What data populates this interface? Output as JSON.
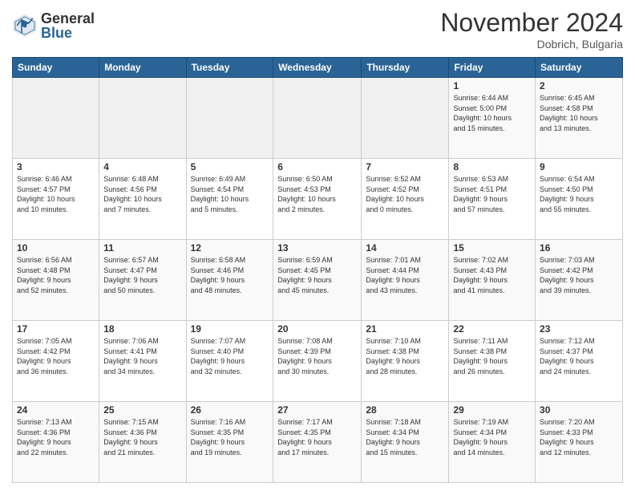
{
  "logo": {
    "general": "General",
    "blue": "Blue"
  },
  "header": {
    "month": "November 2024",
    "location": "Dobrich, Bulgaria"
  },
  "weekdays": [
    "Sunday",
    "Monday",
    "Tuesday",
    "Wednesday",
    "Thursday",
    "Friday",
    "Saturday"
  ],
  "weeks": [
    [
      {
        "day": "",
        "info": ""
      },
      {
        "day": "",
        "info": ""
      },
      {
        "day": "",
        "info": ""
      },
      {
        "day": "",
        "info": ""
      },
      {
        "day": "",
        "info": ""
      },
      {
        "day": "1",
        "info": "Sunrise: 6:44 AM\nSunset: 5:00 PM\nDaylight: 10 hours\nand 15 minutes."
      },
      {
        "day": "2",
        "info": "Sunrise: 6:45 AM\nSunset: 4:58 PM\nDaylight: 10 hours\nand 13 minutes."
      }
    ],
    [
      {
        "day": "3",
        "info": "Sunrise: 6:46 AM\nSunset: 4:57 PM\nDaylight: 10 hours\nand 10 minutes."
      },
      {
        "day": "4",
        "info": "Sunrise: 6:48 AM\nSunset: 4:56 PM\nDaylight: 10 hours\nand 7 minutes."
      },
      {
        "day": "5",
        "info": "Sunrise: 6:49 AM\nSunset: 4:54 PM\nDaylight: 10 hours\nand 5 minutes."
      },
      {
        "day": "6",
        "info": "Sunrise: 6:50 AM\nSunset: 4:53 PM\nDaylight: 10 hours\nand 2 minutes."
      },
      {
        "day": "7",
        "info": "Sunrise: 6:52 AM\nSunset: 4:52 PM\nDaylight: 10 hours\nand 0 minutes."
      },
      {
        "day": "8",
        "info": "Sunrise: 6:53 AM\nSunset: 4:51 PM\nDaylight: 9 hours\nand 57 minutes."
      },
      {
        "day": "9",
        "info": "Sunrise: 6:54 AM\nSunset: 4:50 PM\nDaylight: 9 hours\nand 55 minutes."
      }
    ],
    [
      {
        "day": "10",
        "info": "Sunrise: 6:56 AM\nSunset: 4:48 PM\nDaylight: 9 hours\nand 52 minutes."
      },
      {
        "day": "11",
        "info": "Sunrise: 6:57 AM\nSunset: 4:47 PM\nDaylight: 9 hours\nand 50 minutes."
      },
      {
        "day": "12",
        "info": "Sunrise: 6:58 AM\nSunset: 4:46 PM\nDaylight: 9 hours\nand 48 minutes."
      },
      {
        "day": "13",
        "info": "Sunrise: 6:59 AM\nSunset: 4:45 PM\nDaylight: 9 hours\nand 45 minutes."
      },
      {
        "day": "14",
        "info": "Sunrise: 7:01 AM\nSunset: 4:44 PM\nDaylight: 9 hours\nand 43 minutes."
      },
      {
        "day": "15",
        "info": "Sunrise: 7:02 AM\nSunset: 4:43 PM\nDaylight: 9 hours\nand 41 minutes."
      },
      {
        "day": "16",
        "info": "Sunrise: 7:03 AM\nSunset: 4:42 PM\nDaylight: 9 hours\nand 39 minutes."
      }
    ],
    [
      {
        "day": "17",
        "info": "Sunrise: 7:05 AM\nSunset: 4:42 PM\nDaylight: 9 hours\nand 36 minutes."
      },
      {
        "day": "18",
        "info": "Sunrise: 7:06 AM\nSunset: 4:41 PM\nDaylight: 9 hours\nand 34 minutes."
      },
      {
        "day": "19",
        "info": "Sunrise: 7:07 AM\nSunset: 4:40 PM\nDaylight: 9 hours\nand 32 minutes."
      },
      {
        "day": "20",
        "info": "Sunrise: 7:08 AM\nSunset: 4:39 PM\nDaylight: 9 hours\nand 30 minutes."
      },
      {
        "day": "21",
        "info": "Sunrise: 7:10 AM\nSunset: 4:38 PM\nDaylight: 9 hours\nand 28 minutes."
      },
      {
        "day": "22",
        "info": "Sunrise: 7:11 AM\nSunset: 4:38 PM\nDaylight: 9 hours\nand 26 minutes."
      },
      {
        "day": "23",
        "info": "Sunrise: 7:12 AM\nSunset: 4:37 PM\nDaylight: 9 hours\nand 24 minutes."
      }
    ],
    [
      {
        "day": "24",
        "info": "Sunrise: 7:13 AM\nSunset: 4:36 PM\nDaylight: 9 hours\nand 22 minutes."
      },
      {
        "day": "25",
        "info": "Sunrise: 7:15 AM\nSunset: 4:36 PM\nDaylight: 9 hours\nand 21 minutes."
      },
      {
        "day": "26",
        "info": "Sunrise: 7:16 AM\nSunset: 4:35 PM\nDaylight: 9 hours\nand 19 minutes."
      },
      {
        "day": "27",
        "info": "Sunrise: 7:17 AM\nSunset: 4:35 PM\nDaylight: 9 hours\nand 17 minutes."
      },
      {
        "day": "28",
        "info": "Sunrise: 7:18 AM\nSunset: 4:34 PM\nDaylight: 9 hours\nand 15 minutes."
      },
      {
        "day": "29",
        "info": "Sunrise: 7:19 AM\nSunset: 4:34 PM\nDaylight: 9 hours\nand 14 minutes."
      },
      {
        "day": "30",
        "info": "Sunrise: 7:20 AM\nSunset: 4:33 PM\nDaylight: 9 hours\nand 12 minutes."
      }
    ]
  ]
}
